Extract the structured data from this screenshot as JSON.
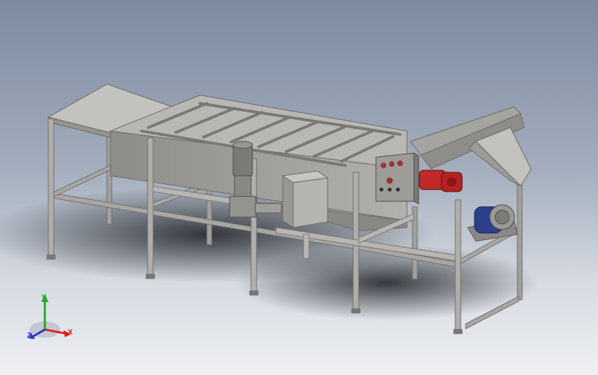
{
  "viewport": {
    "name": "cad-model-viewport",
    "background_top": "#7d8aa0",
    "background_bottom": "#eef0f3"
  },
  "model": {
    "frame_color": "#9c9a97",
    "tank_color": "#a8a6a2",
    "motor_red": "#c0282a",
    "motor_blue": "#2d3f8c",
    "panel_button_red": "#cc2222"
  },
  "triad": {
    "y_label": "Y",
    "x_label": "X",
    "z_label": "Z",
    "y_color": "#22aa22",
    "x_color": "#dd2222",
    "z_color": "#2233cc"
  }
}
